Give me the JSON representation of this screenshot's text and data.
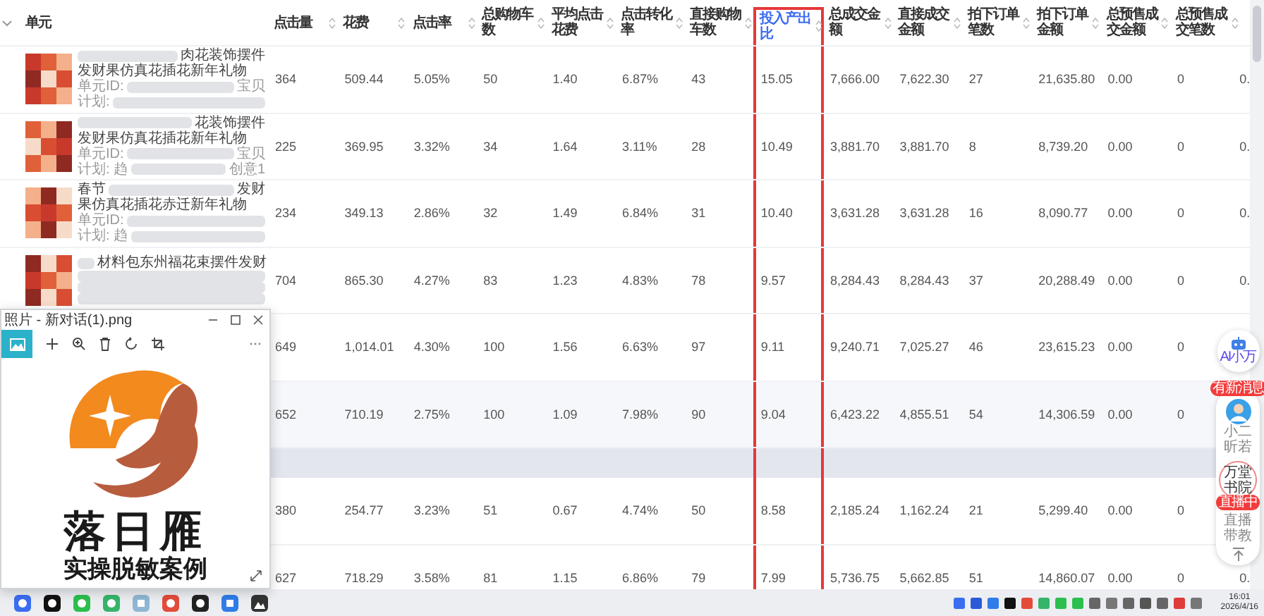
{
  "table": {
    "unit_header": "单元",
    "columns": [
      {
        "label": "点击量",
        "highlighted": false
      },
      {
        "label": "花费",
        "highlighted": false
      },
      {
        "label": "点击率",
        "highlighted": false
      },
      {
        "label": "总购物车数",
        "highlighted": false
      },
      {
        "label": "平均点击花费",
        "highlighted": false
      },
      {
        "label": "点击转化率",
        "highlighted": false
      },
      {
        "label": "直接购物车数",
        "highlighted": false
      },
      {
        "label": "投入产出比",
        "highlighted": true
      },
      {
        "label": "总成交金额",
        "highlighted": false
      },
      {
        "label": "直接成交金额",
        "highlighted": false
      },
      {
        "label": "拍下订单笔数",
        "highlighted": false
      },
      {
        "label": "拍下订单金额",
        "highlighted": false
      },
      {
        "label": "总预售成交金额",
        "highlighted": false
      },
      {
        "label": "总预售成交笔数",
        "highlighted": false
      },
      {
        "highlighted": false
      }
    ],
    "rows": [
      {
        "kind": "data",
        "hovered": false,
        "unit": {
          "lines": [
            {
              "kind": "title",
              "segments": [
                {
                  "kind": "blur"
                },
                {
                  "kind": "text",
                  "text": "肉花装饰摆件"
                }
              ]
            },
            {
              "kind": "title",
              "segments": [
                {
                  "kind": "text",
                  "text": "发财果仿真花插花新年礼物"
                }
              ]
            },
            {
              "kind": "meta",
              "segments": [
                {
                  "kind": "text",
                  "text": "单元ID:"
                },
                {
                  "kind": "blur"
                },
                {
                  "kind": "text",
                  "text": "宝贝"
                }
              ]
            },
            {
              "kind": "meta",
              "segments": [
                {
                  "kind": "text",
                  "text": "计划:"
                },
                {
                  "kind": "blur"
                }
              ]
            }
          ]
        },
        "cells": [
          "364",
          "509.44",
          "5.05%",
          "50",
          "1.40",
          "6.87%",
          "43",
          "15.05",
          "7,666.00",
          "7,622.30",
          "27",
          "21,635.80",
          "0.00",
          "0",
          "0."
        ]
      },
      {
        "kind": "data",
        "hovered": false,
        "unit": {
          "lines": [
            {
              "kind": "title",
              "segments": [
                {
                  "kind": "blur"
                },
                {
                  "kind": "text",
                  "text": "花装饰摆件"
                }
              ]
            },
            {
              "kind": "title",
              "segments": [
                {
                  "kind": "text",
                  "text": "发财果仿真花插花新年礼物"
                }
              ]
            },
            {
              "kind": "meta",
              "segments": [
                {
                  "kind": "text",
                  "text": "单元ID:"
                },
                {
                  "kind": "blur"
                },
                {
                  "kind": "text",
                  "text": "宝贝"
                }
              ]
            },
            {
              "kind": "meta",
              "segments": [
                {
                  "kind": "text",
                  "text": "计划: 趋"
                },
                {
                  "kind": "blur"
                },
                {
                  "kind": "text",
                  "text": "创意1"
                }
              ]
            }
          ]
        },
        "cells": [
          "225",
          "369.95",
          "3.32%",
          "34",
          "1.64",
          "3.11%",
          "28",
          "10.49",
          "3,881.70",
          "3,881.70",
          "8",
          "8,739.20",
          "0.00",
          "0",
          "0."
        ]
      },
      {
        "kind": "data",
        "hovered": false,
        "unit": {
          "lines": [
            {
              "kind": "title",
              "segments": [
                {
                  "kind": "text",
                  "text": "春节"
                },
                {
                  "kind": "blur"
                },
                {
                  "kind": "text",
                  "text": "发财"
                }
              ]
            },
            {
              "kind": "title",
              "segments": [
                {
                  "kind": "text",
                  "text": "果仿真花插花赤迁新年礼物"
                }
              ]
            },
            {
              "kind": "meta",
              "segments": [
                {
                  "kind": "text",
                  "text": "单元ID:"
                },
                {
                  "kind": "blur"
                }
              ]
            },
            {
              "kind": "meta",
              "segments": [
                {
                  "kind": "text",
                  "text": "计划: 趋"
                },
                {
                  "kind": "blur"
                }
              ]
            }
          ]
        },
        "cells": [
          "234",
          "349.13",
          "2.86%",
          "32",
          "1.49",
          "6.84%",
          "31",
          "10.40",
          "3,631.28",
          "3,631.28",
          "16",
          "8,090.77",
          "0.00",
          "0",
          "0."
        ]
      },
      {
        "kind": "data",
        "hovered": false,
        "unit": {
          "lines": [
            {
              "kind": "title",
              "segments": [
                {
                  "kind": "blur"
                },
                {
                  "kind": "text",
                  "text": "材料包东州福花束摆件发财"
                }
              ]
            },
            {
              "kind": "title",
              "segments": [
                {
                  "kind": "blur"
                }
              ]
            },
            {
              "kind": "meta",
              "segments": [
                {
                  "kind": "blur"
                }
              ]
            },
            {
              "kind": "meta",
              "segments": [
                {
                  "kind": "blur"
                }
              ]
            }
          ]
        },
        "cells": [
          "704",
          "865.30",
          "4.27%",
          "83",
          "1.23",
          "4.83%",
          "78",
          "9.57",
          "8,284.43",
          "8,284.43",
          "37",
          "20,288.49",
          "0.00",
          "0",
          "0."
        ]
      },
      {
        "kind": "data",
        "hovered": false,
        "cells": [
          "649",
          "1,014.01",
          "4.30%",
          "100",
          "1.56",
          "6.63%",
          "97",
          "9.11",
          "9,240.71",
          "7,025.27",
          "46",
          "23,615.23",
          "0.00",
          "0",
          null
        ]
      },
      {
        "kind": "data",
        "hovered": true,
        "cells": [
          "652",
          "710.19",
          "2.75%",
          "100",
          "1.09",
          "7.98%",
          "90",
          "9.04",
          "6,423.22",
          "4,855.51",
          "54",
          "14,306.59",
          "0.00",
          "0",
          null
        ]
      },
      {
        "kind": "separator"
      },
      {
        "kind": "data",
        "hovered": false,
        "cells": [
          "380",
          "254.77",
          "3.23%",
          "51",
          "0.67",
          "4.74%",
          "50",
          "8.58",
          "2,185.24",
          "1,162.24",
          "21",
          "5,299.40",
          "0.00",
          "0",
          null
        ]
      },
      {
        "kind": "data",
        "hovered": false,
        "cells": [
          "627",
          "718.29",
          "3.58%",
          "81",
          "1.15",
          "6.86%",
          "79",
          "7.99",
          "5,736.75",
          "5,662.85",
          "51",
          "14,860.07",
          "0.00",
          "0",
          "0."
        ]
      }
    ]
  },
  "photo_viewer": {
    "title": "照片 - 新对话(1).png",
    "logo_title": "落日雁",
    "logo_subtitle": "实操脱敏案例"
  },
  "side_widgets": {
    "ai_label": "AI小万",
    "message_badge": "有新消息",
    "assistant_name": "小二昕若",
    "academy_label": "万堂书院",
    "live_badge": "直播中",
    "live_label": "直播带教"
  },
  "taskbar": {
    "time": "16:01",
    "date": "2026/4/16"
  }
}
